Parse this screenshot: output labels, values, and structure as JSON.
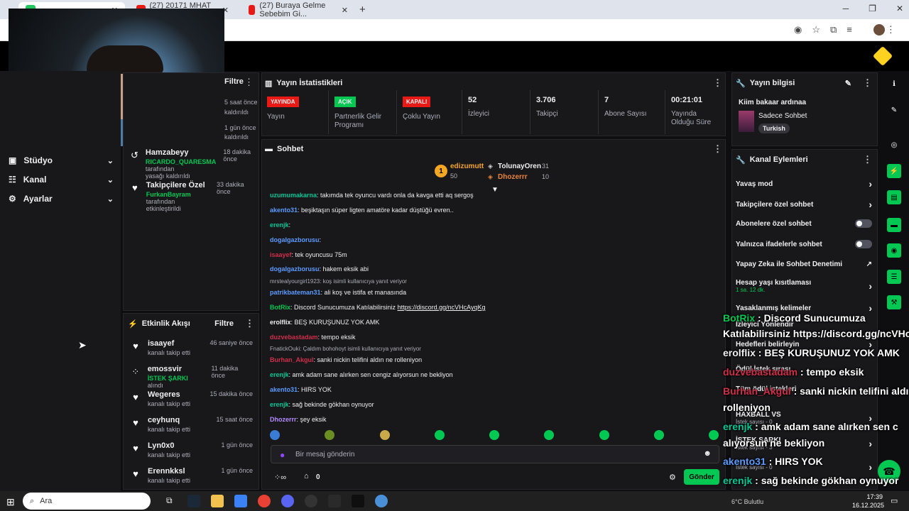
{
  "browser": {
    "tabs": [
      {
        "label": "",
        "active": true
      },
      {
        "label": "(27) 20171 MHAT 207",
        "active": false
      },
      {
        "label": "(27) Buraya Gelme Sebebim Gi...",
        "active": false
      }
    ],
    "new_tab": "+"
  },
  "sidenav": {
    "items": [
      {
        "label": "Stüdyo"
      },
      {
        "label": "Kanal"
      },
      {
        "label": "Ayarlar"
      }
    ]
  },
  "top_feed": {
    "filter": "Filtre",
    "partial_times": [
      "5 saat önce",
      "1 gün önce"
    ],
    "partial_subs": [
      "kaldırıldı",
      "kaldırıldı"
    ],
    "items": [
      {
        "name": "Hamzabeyy",
        "line1": "RICARDO_QUARESMA",
        "line1b": " tarafından",
        "line2": "yasağı kaldırıldı",
        "time": "18 dakika önce"
      },
      {
        "name": "Takipçilere Özel",
        "line1": "FurkanBayram",
        "line1b": " tarafından",
        "line2": "etkinleştirildi",
        "time": "33 dakika önce"
      }
    ]
  },
  "activity": {
    "title": "Etkinlik Akışı",
    "filter": "Filtre",
    "items": [
      {
        "name": "isaayef",
        "sub": "kanalı takip etti",
        "time": "46 saniye önce",
        "icon": "heart-icon"
      },
      {
        "name": "emossvir",
        "hl": "İSTEK ŞARKI",
        "sub": " alındı",
        "time": "11 dakika önce",
        "icon": "points-icon"
      },
      {
        "name": "Wegeres",
        "sub": "kanalı takip etti",
        "time": "15 dakika önce",
        "icon": "heart-icon"
      },
      {
        "name": "ceyhunq",
        "sub": "kanalı takip etti",
        "time": "15 saat önce",
        "icon": "heart-icon"
      },
      {
        "name": "Lyn0x0",
        "sub": "kanalı takip etti",
        "time": "1 gün önce",
        "icon": "heart-icon"
      },
      {
        "name": "Erennkksl",
        "sub": "kanalı takip etti",
        "time": "1 gün önce",
        "icon": "heart-icon"
      }
    ]
  },
  "stats": {
    "title": "Yayın İstatistikleri",
    "cards": [
      {
        "badge": "YAYINDA",
        "badge_color": "#e91916",
        "label": "Yayın"
      },
      {
        "badge": "AÇIK",
        "badge_color": "#00c853",
        "label": "Partnerlik Gelir Programı"
      },
      {
        "badge": "KAPALI",
        "badge_color": "#e91916",
        "label": "Çoklu Yayın"
      },
      {
        "value": "52",
        "label": "İzleyici"
      },
      {
        "value": "3.706",
        "label": "Takipçi"
      },
      {
        "value": "7",
        "label": "Abone Sayısı"
      },
      {
        "value": "00:21:01",
        "label": "Yayında Olduğu Süre"
      }
    ]
  },
  "stream_info": {
    "title": "Yayın bilgisi",
    "stream_title": "Kiim bakaar ardınaa",
    "category": "Sadece Sohbet",
    "tag": "Turkish"
  },
  "chat": {
    "title": "Sohbet",
    "leaders": [
      {
        "rank": "1",
        "name": "edizumutt",
        "count": "50"
      },
      {
        "name": "TolunayOren",
        "count": "31"
      },
      {
        "name": "Dhozerrr",
        "count": "10"
      }
    ],
    "messages": [
      {
        "user": "uzumumakarna",
        "text": ": takımda tek oyuncu vardı onla da kavga etti aq sergoş",
        "color": "#00c896"
      },
      {
        "user": "akento31",
        "text": ": beşiktaşın süper ligten amatöre kadar düştüğü evren..",
        "color": "#5b9bff"
      },
      {
        "user": "erenjk",
        "text": ": ",
        "color": "#00c896"
      },
      {
        "user": "dogalgazborusu",
        "text": ": ",
        "color": "#5b9bff"
      },
      {
        "user": "isaayef",
        "text": ": tek oyuncusu 75m",
        "color": "#d02e4a"
      },
      {
        "user": "dogalgazborusu",
        "text": ": hakem eksik abi",
        "color": "#5b9bff"
      },
      {
        "reply": "mrstealyourgirl1923: koş isimli kullanıcıya yanıt veriyor",
        "user": "patrikbateman31",
        "text": ": ali koş ve istifa et manasında",
        "color": "#5b9bff"
      },
      {
        "user": "BotRix",
        "text": ": Discord Sunucumuza Katılabilirsiniz ",
        "link": "https://discord.gg/ncVHcAyqKg",
        "color": "#00c853"
      },
      {
        "user": "erolflix",
        "text": ": BEŞ KURUŞUNUZ YOK AMK",
        "color": "#efeff1"
      },
      {
        "user": "duzvebastadam",
        "text": ": tempo eksik",
        "color": "#d02e4a"
      },
      {
        "reply": "FnatickOuki: Çaldım bohohoyt isimli kullanıcıya yanıt veriyor",
        "user": "Burhan_Akgul",
        "text": ": sanki nickin telifini aldın ne rolleniyon",
        "color": "#d02e4a"
      },
      {
        "user": "erenjk",
        "text": ": amk adam sane alırken sen cengiz alıyorsun ne bekliyon",
        "color": "#00c896"
      },
      {
        "user": "akento31",
        "text": ": HIRS YOK",
        "color": "#5b9bff"
      },
      {
        "user": "erenjk",
        "text": ": sağ bekinde gökhan oynuyor",
        "color": "#00c896"
      },
      {
        "user": "Dhozerrr",
        "text": ": şey eksik",
        "color": "#b38bff"
      }
    ],
    "input_placeholder": "Bir mesaj gönderin",
    "points": "0",
    "send": "Gönder"
  },
  "actions": {
    "title": "Kanal Eylemleri",
    "items": [
      {
        "label": "Yavaş mod",
        "type": "arrow"
      },
      {
        "label": "Takipçilere özel sohbet",
        "type": "arrow"
      },
      {
        "label": "Abonelere özel sohbet",
        "type": "toggle"
      },
      {
        "label": "Yalnızca ifadelerle sohbet",
        "type": "toggle"
      },
      {
        "label": "Yapay Zeka ile Sohbet Denetimi",
        "type": "ext"
      },
      {
        "label": "Hesap yaşı kısıtlaması",
        "sub": "1 sa. 12 dk.",
        "type": "arrow"
      },
      {
        "label": "Yasaklanmış kelimeler",
        "type": "arrow"
      },
      {
        "label": "İzleyici Yönlendir",
        "type": "none"
      },
      {
        "label": "Hedefleri belirleyin",
        "type": "arrow"
      },
      {
        "label": "Ödül İstek sırası",
        "type": "none"
      },
      {
        "label": "Tüm ödül istekleri",
        "type": "none"
      },
      {
        "label": "HAXBALL VS",
        "sub": "İstek sayısı - 0",
        "type": "arrow"
      },
      {
        "label": "İSTEK ŞARKI",
        "sub": "İstek sayısı - 3",
        "type": "arrow"
      },
      {
        "label": "",
        "sub": "İstek sayısı - 0",
        "type": "arrow"
      }
    ]
  },
  "overlay": [
    {
      "user": "BotRix",
      "text": " : Discord Sunucumuza",
      "color": "#00c853"
    },
    {
      "user": "",
      "text": "Katılabilirsiniz https://discord.gg/ncVHc",
      "color": "#fff"
    },
    {
      "user": "erolflix",
      "text": " : BEŞ KURUŞUNUZ YOK AMK",
      "color": "#efeff1"
    },
    {
      "user": "duzvebastadam",
      "text": " : tempo eksik",
      "color": "#d02e4a"
    },
    {
      "user": "Burhan_Akgul",
      "text": " : sanki nickin telifini aldı",
      "color": "#d02e4a"
    },
    {
      "user": "",
      "text": "rolleniyon",
      "color": "#fff"
    },
    {
      "user": "erenjk",
      "text": " : amk adam sane alırken sen c",
      "color": "#00c896"
    },
    {
      "user": "",
      "text": "alıyorsun ne bekliyon",
      "color": "#fff"
    },
    {
      "user": "akento31",
      "text": " : HIRS YOK",
      "color": "#5b9bff"
    },
    {
      "user": "erenjk",
      "text": " : sağ bekinde gökhan oynuyor",
      "color": "#00c896"
    },
    {
      "user": "Dhozerrr",
      "text": " : şey eksik",
      "color": "#b38bff"
    }
  ],
  "taskbar": {
    "search": "Ara",
    "time": "17:39",
    "date": "16.12.2025",
    "weather": "6°C Bulutlu"
  }
}
